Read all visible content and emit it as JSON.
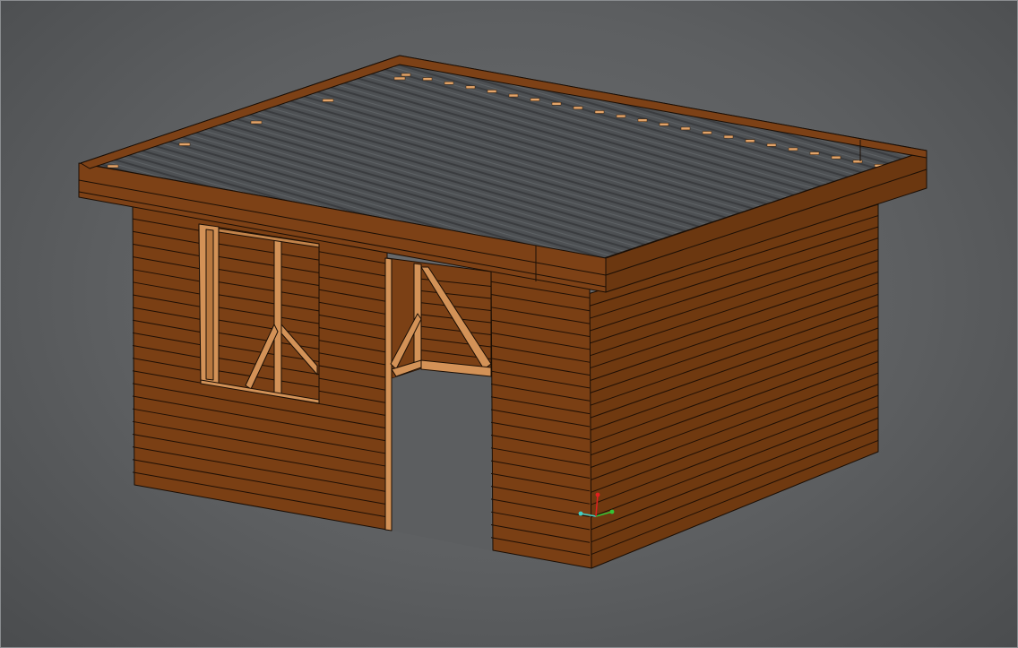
{
  "viewport": {
    "background": "#5f6163",
    "frame_edge": "#888b8e"
  },
  "model": {
    "wood_color": "#7a3f14",
    "wood_side_color": "#6e3810",
    "wood_light_color": "#d6985e",
    "roof_panel_color": "#4e5154",
    "edge_color": "#1a0e05"
  },
  "axis_gizmo": {
    "x_color": "#35c435",
    "y_color": "#40d0c8",
    "z_color": "#e02020",
    "origin_icon": "axis-triad-icon"
  }
}
